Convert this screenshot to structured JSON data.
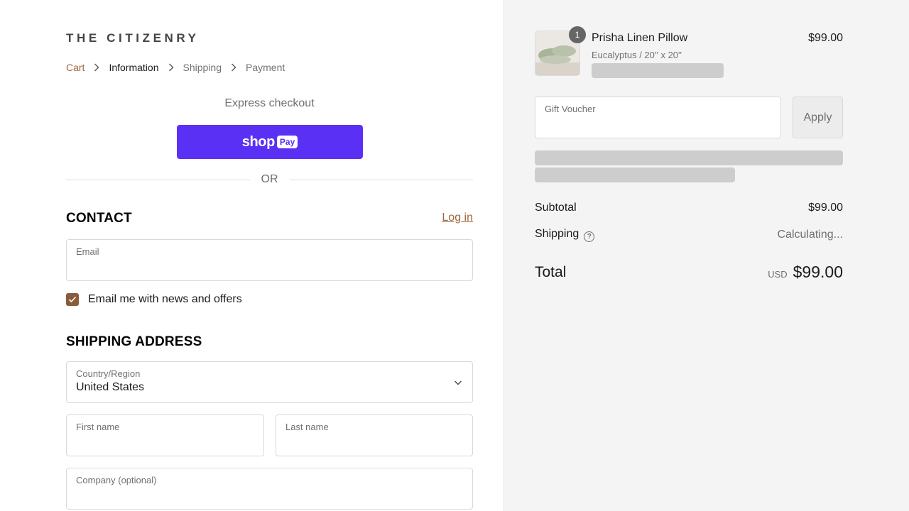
{
  "brand": {
    "logo_text": "THE CITIZENRY"
  },
  "breadcrumb": {
    "cart": "Cart",
    "information": "Information",
    "shipping": "Shipping",
    "payment": "Payment"
  },
  "express": {
    "label": "Express checkout",
    "shop_text": "shop",
    "pay_text": "Pay",
    "or_text": "OR"
  },
  "contact": {
    "title": "CONTACT",
    "login_label": "Log in",
    "email_label": "Email",
    "email_value": "",
    "newsletter_label": "Email me with news and offers",
    "newsletter_checked": true
  },
  "shipping_address": {
    "title": "SHIPPING ADDRESS",
    "country_label": "Country/Region",
    "country_value": "United States",
    "first_name_label": "First name",
    "last_name_label": "Last name",
    "company_label": "Company (optional)"
  },
  "order": {
    "item": {
      "quantity": "1",
      "name": "Prisha Linen Pillow",
      "variant": "Eucalyptus / 20'' x 20''",
      "price": "$99.00"
    },
    "voucher_label": "Gift Voucher",
    "apply_label": "Apply",
    "subtotal_label": "Subtotal",
    "subtotal_value": "$99.00",
    "shipping_label": "Shipping",
    "shipping_help_icon": "?",
    "shipping_value": "Calculating...",
    "total_label": "Total",
    "currency": "USD",
    "total_value": "$99.00"
  },
  "colors": {
    "accent": "#a0673e",
    "shop_pay": "#5a31f4",
    "checkbox": "#8a5a3c",
    "sidebar_bg": "#f4f4f4",
    "skeleton": "#cdcdcd"
  },
  "icons": {
    "breadcrumb_separator": "chevron-right-icon",
    "select_caret": "chevron-down-icon",
    "checkbox_mark": "check-icon",
    "shipping_help": "question-circle-icon"
  }
}
